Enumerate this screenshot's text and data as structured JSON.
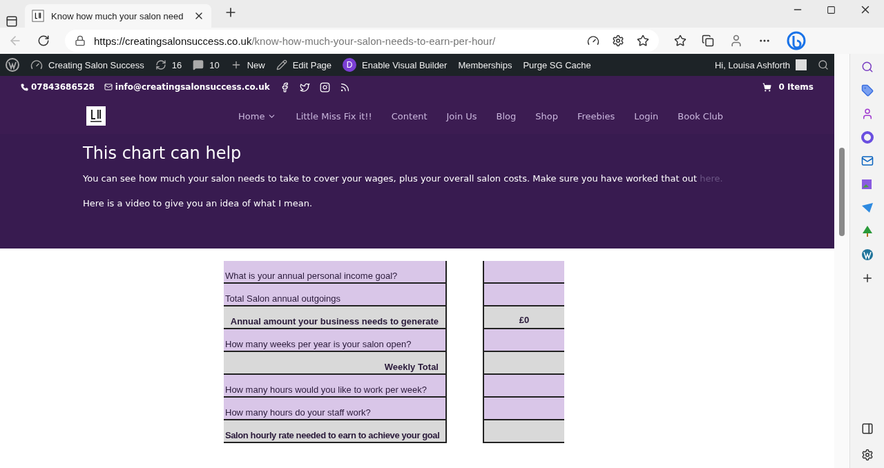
{
  "browser": {
    "tab_title": "Know how much your salon need",
    "url_domain": "https://creatingsalonsuccess.co.uk",
    "url_path": "/know-how-much-your-salon-needs-to-earn-per-hour/"
  },
  "admin_bar": {
    "site": "Creating Salon Success",
    "updates": "16",
    "comments": "10",
    "new": "New",
    "edit": "Edit Page",
    "builder_badge": "D",
    "builder": "Enable Visual Builder",
    "memberships": "Memberships",
    "purge": "Purge SG Cache",
    "greeting": "Hi, Louisa Ashforth"
  },
  "top_bar": {
    "phone": "07843686528",
    "email": "info@creatingsalonsuccess.co.uk",
    "cart": "0 Items"
  },
  "nav": [
    {
      "label": "Home",
      "dropdown": true
    },
    {
      "label": "Little Miss Fix it!!",
      "dropdown": false
    },
    {
      "label": "Content",
      "dropdown": false
    },
    {
      "label": "Join Us",
      "dropdown": false
    },
    {
      "label": "Blog",
      "dropdown": false
    },
    {
      "label": "Shop",
      "dropdown": false
    },
    {
      "label": "Freebies",
      "dropdown": false
    },
    {
      "label": "Login",
      "dropdown": false
    },
    {
      "label": "Book Club",
      "dropdown": false
    }
  ],
  "hero": {
    "title": "This chart can help",
    "text": "You can see how much your salon needs to take to cover your wages, plus your overall salon costs. Make sure you have worked that out",
    "link": "here.",
    "video_text": "Here is a video to give you an idea of what I mean."
  },
  "calculator": [
    {
      "kind": "input",
      "label": "What is your annual personal income goal?"
    },
    {
      "kind": "input",
      "label": "Total Salon annual outgoings"
    },
    {
      "kind": "total",
      "label": "Annual amount your business needs to generate",
      "value": "£0"
    },
    {
      "kind": "input",
      "label": "How many weeks per year is your salon open?"
    },
    {
      "kind": "total",
      "label": "Weekly Total"
    },
    {
      "kind": "input",
      "label": "How many hours would you like to work per week?"
    },
    {
      "kind": "input",
      "label": "How many hours do your staff work?"
    },
    {
      "kind": "result",
      "label": "Salon hourly rate needed to earn to achieve your goal"
    }
  ]
}
